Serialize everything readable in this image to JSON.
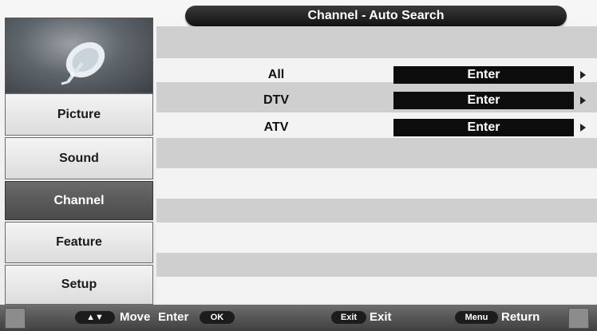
{
  "header": {
    "title": "Channel - Auto Search"
  },
  "sidebar": {
    "icon": "satellite-dish-icon",
    "items": [
      {
        "label": "Picture",
        "active": false
      },
      {
        "label": "Sound",
        "active": false
      },
      {
        "label": "Channel",
        "active": true
      },
      {
        "label": "Feature",
        "active": false
      },
      {
        "label": "Setup",
        "active": false
      }
    ]
  },
  "main": {
    "rows": [
      {
        "label": "All",
        "value": "Enter"
      },
      {
        "label": "DTV",
        "value": "Enter"
      },
      {
        "label": "ATV",
        "value": "Enter"
      }
    ]
  },
  "footer": {
    "nav_key": "▲▼",
    "move_label": "Move",
    "enter_label": "Enter",
    "ok_key": "OK",
    "exit_key": "Exit",
    "exit_label": "Exit",
    "menu_key": "Menu",
    "return_label": "Return"
  },
  "colors": {
    "active_item": "#555555",
    "enter_button": "#0d0d0d",
    "title_bar": "#1e1e1e"
  }
}
